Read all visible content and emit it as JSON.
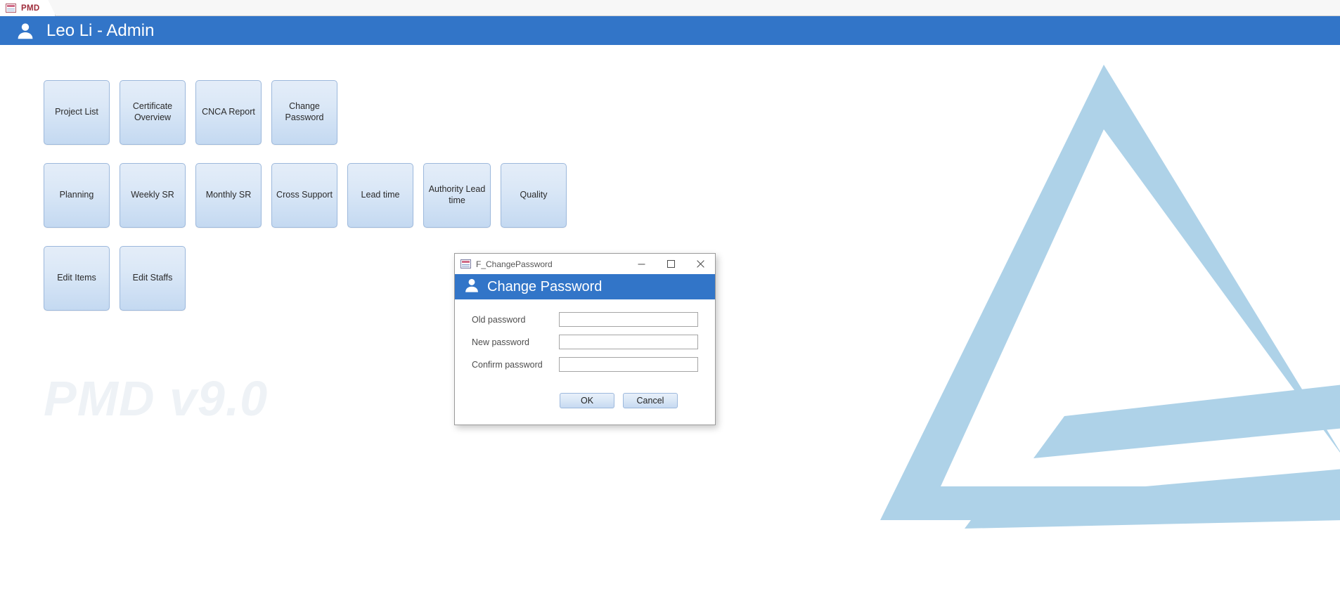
{
  "tab": {
    "label": "PMD",
    "icon": "form-table-icon"
  },
  "header": {
    "title": "Leo Li - Admin",
    "icon": "person-icon",
    "accent_color": "#3275c8"
  },
  "watermark": {
    "version_text": "PMD v9.0",
    "logo_icon": "triangle-logo",
    "logo_color": "#aed2e8",
    "text_color": "#eef2f6"
  },
  "menu": {
    "rows": [
      [
        {
          "label": "Project List",
          "name": "project-list"
        },
        {
          "label": "Certificate Overview",
          "name": "certificate-overview"
        },
        {
          "label": "CNCA Report",
          "name": "cnca-report"
        },
        {
          "label": "Change Password",
          "name": "change-password"
        }
      ],
      [
        {
          "label": "Planning",
          "name": "planning"
        },
        {
          "label": "Weekly SR",
          "name": "weekly-sr"
        },
        {
          "label": "Monthly SR",
          "name": "monthly-sr"
        },
        {
          "label": "Cross Support",
          "name": "cross-support"
        },
        {
          "label": "Lead time",
          "name": "lead-time"
        },
        {
          "label": "Authority Lead time",
          "name": "authority-lead-time"
        },
        {
          "label": "Quality",
          "name": "quality"
        }
      ],
      [
        {
          "label": "Edit Items",
          "name": "edit-items"
        },
        {
          "label": "Edit Staffs",
          "name": "edit-staffs"
        }
      ]
    ]
  },
  "dialog": {
    "window_title": "F_ChangePassword",
    "banner_title": "Change Password",
    "banner_icon": "person-icon",
    "title_icon": "form-table-icon",
    "minimize_glyph": "—",
    "maximize_glyph": "□",
    "close_glyph": "✕",
    "fields": [
      {
        "label": "Old password",
        "value": "",
        "placeholder": "",
        "name": "old-password"
      },
      {
        "label": "New password",
        "value": "",
        "placeholder": "",
        "name": "new-password"
      },
      {
        "label": "Confirm password",
        "value": "",
        "placeholder": "",
        "name": "confirm-password"
      }
    ],
    "ok_label": "OK",
    "cancel_label": "Cancel"
  }
}
